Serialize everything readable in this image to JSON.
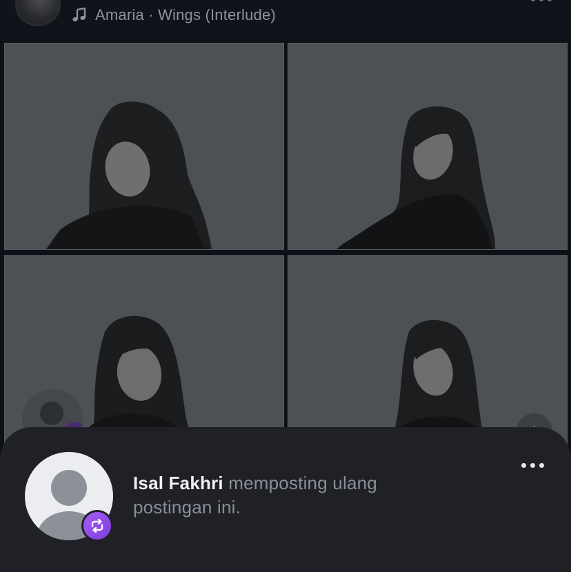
{
  "post": {
    "music_line": "Amaria · Wings (Interlude)"
  },
  "icons": {
    "music": "music-note-icon",
    "more": "more-horizontal-icon",
    "mute": "speaker-muted-icon",
    "repost": "repost-icon",
    "avatar": "default-user-icon"
  },
  "repost_notice": {
    "username": "Isal Fakhri",
    "message_line1": "memposting ulang",
    "message_line2": "postingan ini."
  },
  "colors": {
    "background": "#0d1016",
    "sheet": "#202127",
    "repost_accent": "#9a52f0",
    "photo_backdrop": "#4d5155"
  }
}
